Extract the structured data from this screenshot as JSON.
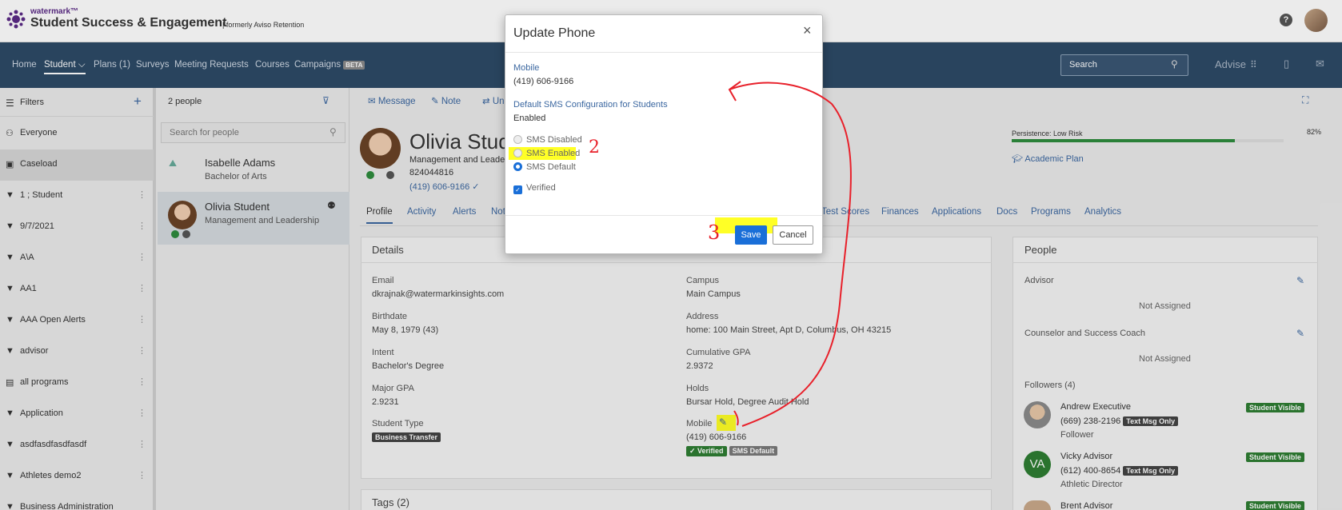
{
  "header": {
    "brand_small": "watermark™",
    "brand_title": "Student Success & Engagement",
    "brand_sub": "| formerly Aviso Retention",
    "help_glyph": "?"
  },
  "nav": {
    "items": [
      "Home",
      "Student ⌵",
      "Plans (1)",
      "Surveys",
      "Meeting Requests",
      "Courses",
      "Campaigns"
    ],
    "beta": "BETA",
    "search_placeholder": "Search",
    "advise": "Advise"
  },
  "sidebar": {
    "header": "Filters",
    "add": "+",
    "items": [
      "Everyone",
      "Caseload",
      "1 ; Student",
      "9/7/2021",
      "A\\A",
      "AA1",
      "AAA Open Alerts",
      "advisor",
      "all programs",
      "Application",
      "asdfasdfasdfasdf",
      "Athletes demo2",
      "Business Administration"
    ]
  },
  "people": {
    "count": "2 people",
    "search_placeholder": "Search for people",
    "list": [
      {
        "name": "Isabelle Adams",
        "sub": "Bachelor of Arts"
      },
      {
        "name": "Olivia Student",
        "sub": "Management and Leadership"
      }
    ]
  },
  "actions": [
    "Message",
    "Note",
    "Un"
  ],
  "student": {
    "name": "Olivia Stud",
    "program": "Management and Leade",
    "id": "824044816",
    "phone": "(419) 606-9166 ✓"
  },
  "tabs": [
    "Profile",
    "Activity",
    "Alerts",
    "Not",
    "Test Scores",
    "Finances",
    "Applications",
    "Docs",
    "Programs",
    "Analytics"
  ],
  "persistence": {
    "label": "Persistence: Low Risk",
    "value_text": "82%",
    "value": 0.82
  },
  "academic_plan": "Academic Plan",
  "details": {
    "title": "Details",
    "left": [
      {
        "label": "Email",
        "value": "dkrajnak@watermarkinsights.com"
      },
      {
        "label": "Birthdate",
        "value": "May 8, 1979 (43)"
      },
      {
        "label": "Intent",
        "value": "Bachelor's Degree"
      },
      {
        "label": "Major GPA",
        "value": "2.9231"
      },
      {
        "label": "Student Type",
        "value": "Business Transfer"
      }
    ],
    "right": [
      {
        "label": "Campus",
        "value": "Main Campus"
      },
      {
        "label": "Address",
        "value": "home: 100 Main Street, Apt D, Columbus, OH 43215"
      },
      {
        "label": "Cumulative GPA",
        "value": "2.9372"
      },
      {
        "label": "Holds",
        "value": "Bursar Hold, Degree Audit Hold"
      },
      {
        "label": "Mobile",
        "value": "(419) 606-9166"
      }
    ],
    "verified_badge": "✓ Verified",
    "sms_badge": "SMS Default"
  },
  "tags_title": "Tags (2)",
  "people_card": {
    "title": "People",
    "advisor_label": "Advisor",
    "advisor_value": "Not Assigned",
    "coach_label": "Counselor and Success Coach",
    "coach_value": "Not Assigned",
    "followers_label": "Followers (4)",
    "followers": [
      {
        "name": "Andrew Executive",
        "phone": "(669) 238-2196",
        "badge": "Text Msg Only",
        "role": "Follower",
        "visible": "Student Visible"
      },
      {
        "name": "Vicky Advisor",
        "initials": "VA",
        "phone": "(612) 400-8654",
        "badge": "Text Msg Only",
        "role": "Athletic Director",
        "visible": "Student Visible"
      },
      {
        "name": "Brent Advisor",
        "visible": "Student Visible"
      }
    ]
  },
  "modal": {
    "title": "Update Phone",
    "close": "×",
    "mobile_label": "Mobile",
    "mobile_value": "(419) 606-9166",
    "sms_label": "Default SMS Configuration for Students",
    "sms_value": "Enabled",
    "options": [
      "SMS Disabled",
      "SMS Enabled",
      "SMS Default"
    ],
    "selected_option": "SMS Default",
    "verified": "Verified",
    "save": "Save",
    "cancel": "Cancel"
  },
  "annotations": [
    "2",
    "3"
  ],
  "colors": {
    "nav": "#2d4a67",
    "link": "#3b67a0",
    "primary": "#1a6fd8",
    "success": "#2e7d32",
    "highlight": "#ffff00",
    "annotation": "#e8202a"
  }
}
